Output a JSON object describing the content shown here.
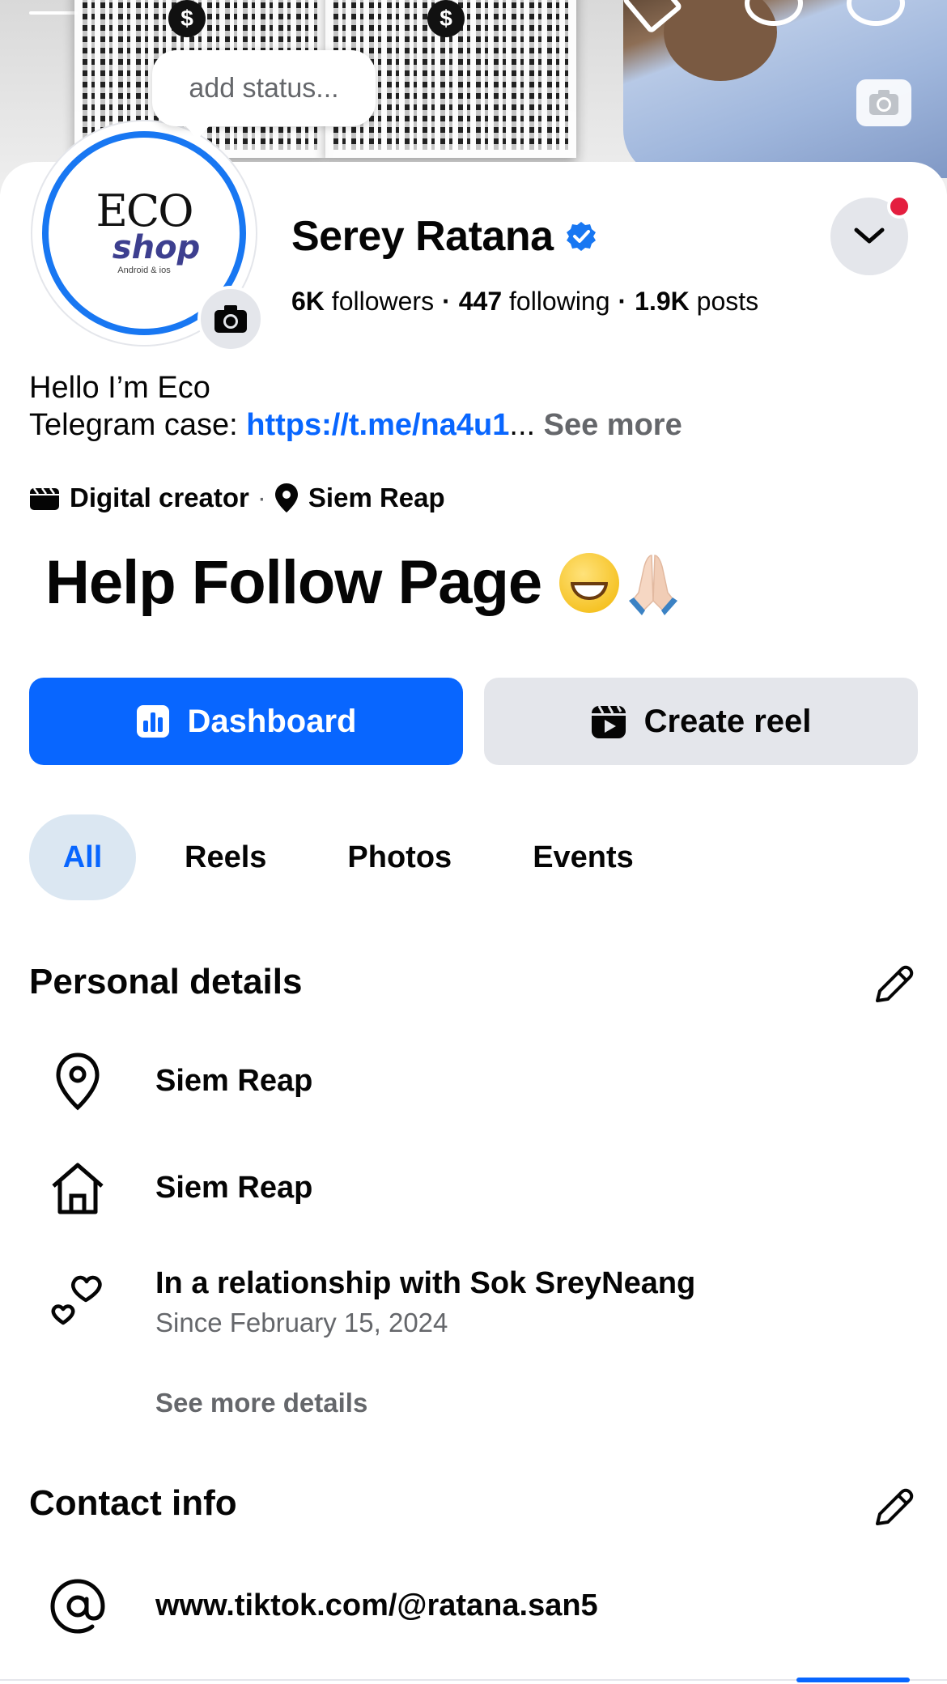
{
  "status": {
    "placeholder": "add status..."
  },
  "profile": {
    "name": "Serey Ratana",
    "avatar_logo": {
      "line1": "ECO",
      "line2": "shop",
      "line3": "Android & ios"
    },
    "stats": {
      "followers_count": "6K",
      "followers_label": "followers",
      "following_count": "447",
      "following_label": "following",
      "posts_count": "1.9K",
      "posts_label": "posts",
      "separator": "·"
    }
  },
  "bio": {
    "line1": "Hello I’m Eco",
    "line2_prefix": "Telegram case: ",
    "link": "https://t.me/na4u1",
    "ellipsis": "...",
    "see_more": "See more"
  },
  "meta": {
    "category": "Digital creator",
    "separator": "·",
    "location": "Siem Reap"
  },
  "headline": {
    "text": "Help Follow Page"
  },
  "actions": {
    "dashboard": "Dashboard",
    "create_reel": "Create reel"
  },
  "tabs": [
    {
      "label": "All",
      "active": true
    },
    {
      "label": "Reels"
    },
    {
      "label": "Photos"
    },
    {
      "label": "Events"
    }
  ],
  "personal_details": {
    "title": "Personal details",
    "items": [
      {
        "icon": "location-pin-icon",
        "text": "Siem Reap"
      },
      {
        "icon": "home-icon",
        "text": "Siem Reap"
      },
      {
        "icon": "hearts-icon",
        "text": "In a relationship with Sok SreyNeang",
        "sub": "Since February 15, 2024"
      }
    ],
    "see_more": "See more details"
  },
  "contact_info": {
    "title": "Contact info",
    "items": [
      {
        "icon": "at-icon",
        "text": "www.tiktok.com/@ratana.san5"
      }
    ]
  },
  "colors": {
    "primary": "#0866ff",
    "secondary_bg": "#e4e6eb",
    "muted_text": "#65676b",
    "notification": "#e41e3f"
  }
}
